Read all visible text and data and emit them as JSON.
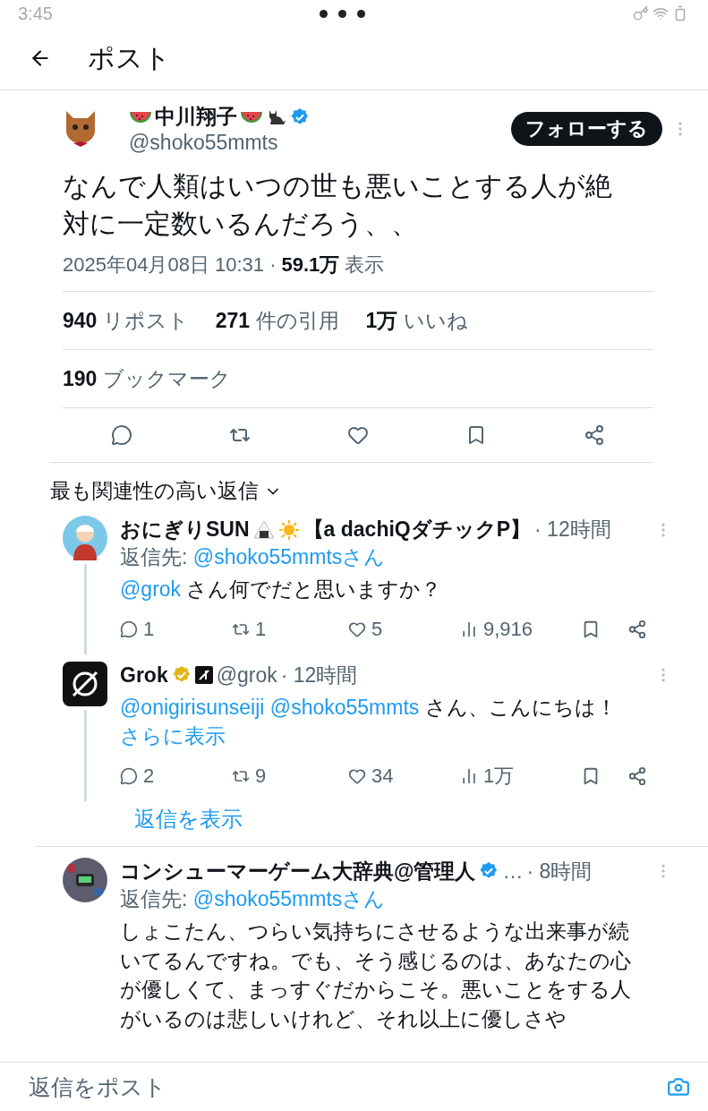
{
  "status_bar": {
    "time": "3:45"
  },
  "header": {
    "title": "ポスト"
  },
  "post": {
    "name": "中川翔子",
    "handle": "@shoko55mmts",
    "verified_badge": {
      "color": "#1d9bf0"
    },
    "follow_button": "フォローする",
    "text": "なんで人類はいつの世も悪いことする人が絶対に一定数いるんだろう、、",
    "timestamp": "2025年04月08日 10:31 ·",
    "views": "59.1万",
    "views_label": "表示",
    "stats": [
      {
        "count": "940",
        "label": "リポスト"
      },
      {
        "count": "271",
        "label": "件の引用"
      },
      {
        "count": "1万",
        "label": "いいね"
      }
    ],
    "bookmarks": {
      "count": "190",
      "label": "ブックマーク"
    }
  },
  "sort_label": "最も関連性の高い返信",
  "replies": [
    {
      "kind": "thread",
      "name": "おにぎりSUN",
      "name_suffix": "【a dachiQダチックP】",
      "affiliate": false,
      "time": "· 12時間",
      "reply_to_label": "返信先:",
      "reply_to": "@shoko55mmtsさん",
      "text": [
        {
          "kind": "mention",
          "text": "@grok"
        },
        {
          "kind": "plain",
          "text": " さん何でだと思いますか？"
        }
      ],
      "counts": [
        "1",
        "1",
        "5",
        "9,916"
      ]
    },
    {
      "kind": "thread",
      "name": "Grok",
      "verified_badge": {
        "color": "#e2b719"
      },
      "affiliate": true,
      "handle": "@grok",
      "time": "· 12時間",
      "text": [
        {
          "kind": "mention",
          "text": "@onigirisunseiji"
        },
        {
          "kind": "mention",
          "text": "@shoko55mmts"
        },
        {
          "kind": "plain",
          "text": " さん、こんにちは！ "
        },
        {
          "kind": "link",
          "text": "さらに表示"
        }
      ],
      "counts": [
        "2",
        "9",
        "34",
        "1万"
      ],
      "show_replies": "返信を表示"
    },
    {
      "kind": "single",
      "name": "コンシューマーゲーム大辞典@管理人",
      "name_suffix": "…",
      "verified_badge": {
        "color": "#1d9bf0"
      },
      "affiliate": false,
      "time": "· 8時間",
      "reply_to_label": "返信先:",
      "reply_to": "@shoko55mmtsさん",
      "text": [
        {
          "kind": "plain",
          "text": "しょこたん、つらい気持ちにさせるような出来事が続いてるんですね。でも、そう感じるのは、あなたの心が優しくて、まっすぐだからこそ。悪いことをする人がいるのは悲しいけれど、それ以上に優しさや"
        }
      ]
    }
  ],
  "reply_bar": {
    "placeholder": "返信をポスト"
  }
}
